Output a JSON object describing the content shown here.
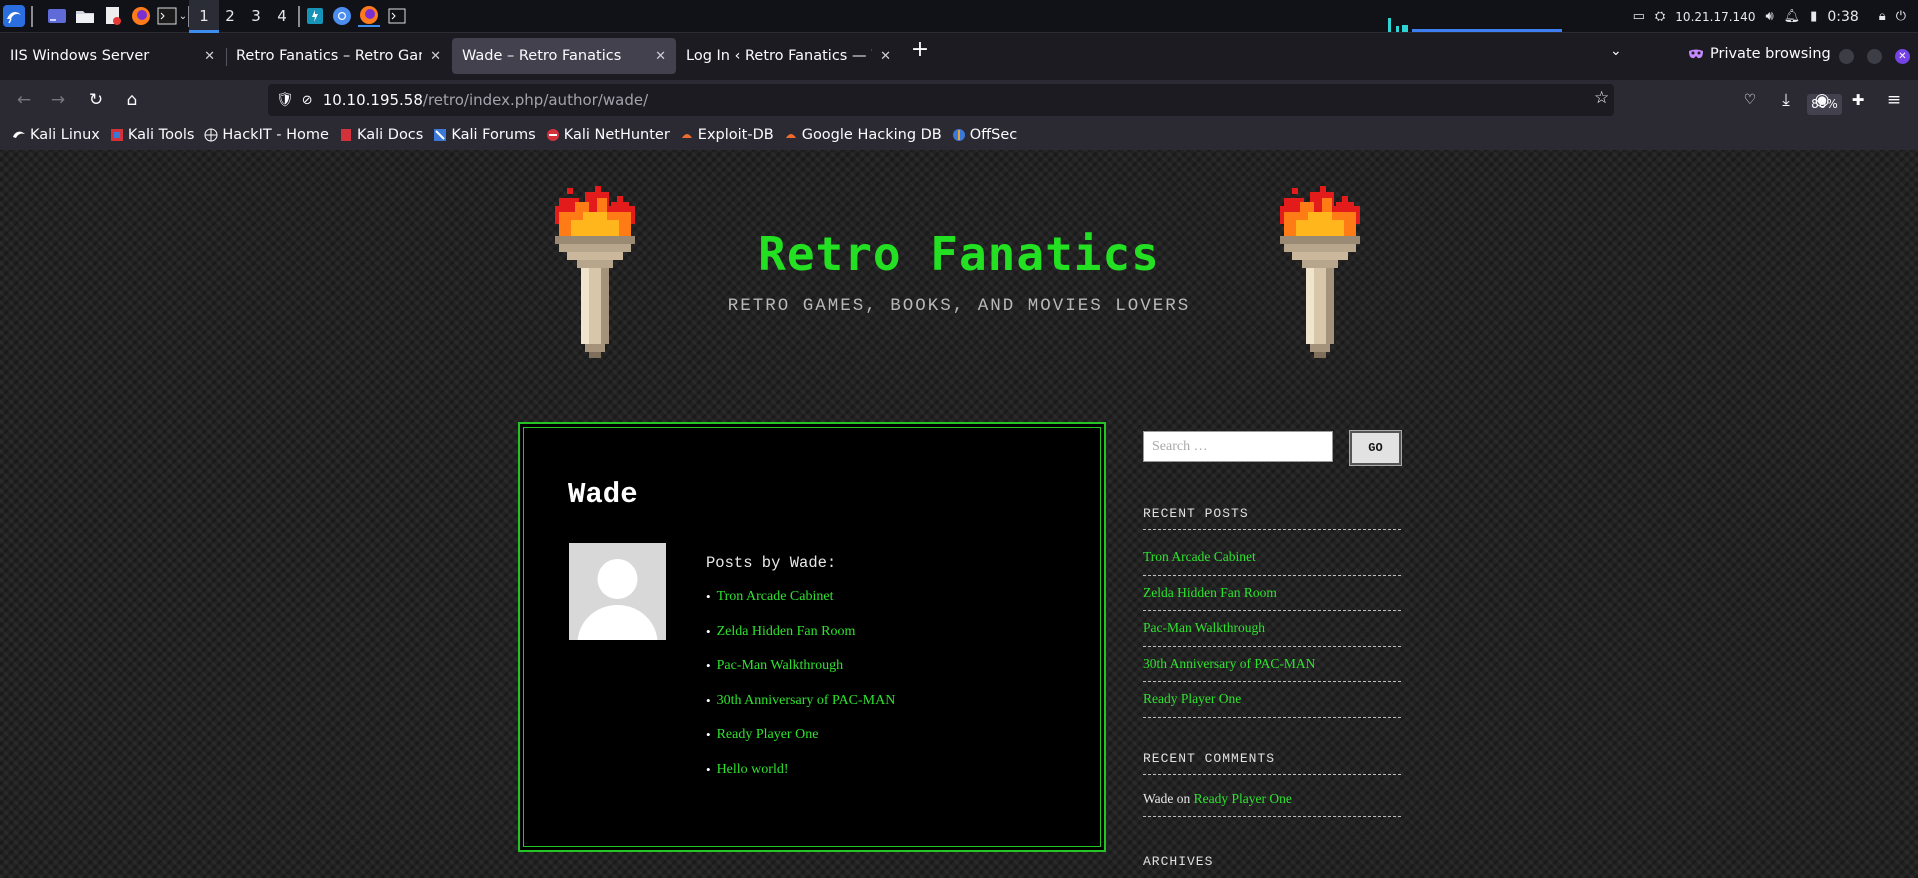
{
  "panel": {
    "workspaces": [
      "1",
      "2",
      "3",
      "4"
    ],
    "active_workspace": "1",
    "ip": "10.21.17.140",
    "clock": "0:38",
    "icons": [
      "kali-menu-icon",
      "desktop-icon",
      "file-manager-icon",
      "text-editor-icon",
      "firefox-icon",
      "terminal-icon",
      "burp-icon",
      "chromium-icon",
      "firefox-icon",
      "terminal-icon"
    ]
  },
  "tabs": [
    {
      "title": "IIS Windows Server",
      "active": false
    },
    {
      "title": "Retro Fanatics – Retro Games",
      "active": false
    },
    {
      "title": "Wade – Retro Fanatics",
      "active": true
    },
    {
      "title": "Log In ‹ Retro Fanatics — Wo",
      "active": false
    }
  ],
  "browser": {
    "private_label": "Private browsing",
    "url_host": "10.10.195.58",
    "url_path": "/retro/index.php/author/wade/",
    "zoom": "80%",
    "new_tab": "+"
  },
  "bookmarks": [
    {
      "label": "Kali Linux",
      "icon": "kali-icon"
    },
    {
      "label": "Kali Tools",
      "icon": "kali-tools-icon"
    },
    {
      "label": "HackIT - Home",
      "icon": "globe-icon"
    },
    {
      "label": "Kali Docs",
      "icon": "kali-docs-icon"
    },
    {
      "label": "Kali Forums",
      "icon": "kali-forums-icon"
    },
    {
      "label": "Kali NetHunter",
      "icon": "nethunter-icon"
    },
    {
      "label": "Exploit-DB",
      "icon": "exploit-db-icon"
    },
    {
      "label": "Google Hacking DB",
      "icon": "ghdb-icon"
    },
    {
      "label": "OffSec",
      "icon": "offsec-icon"
    }
  ],
  "site": {
    "title": "Retro Fanatics",
    "description": "RETRO GAMES, BOOKS, AND MOVIES LOVERS"
  },
  "author": {
    "name": "Wade",
    "posts_heading": "Posts by Wade:",
    "posts": [
      "Tron Arcade Cabinet",
      "Zelda Hidden Fan Room",
      "Pac-Man Walkthrough",
      "30th Anniversary of PAC-MAN",
      "Ready Player One",
      "Hello world!"
    ]
  },
  "sidebar": {
    "search_placeholder": "Search …",
    "go_label": "GO",
    "recent_posts_title": "RECENT POSTS",
    "recent_posts": [
      "Tron Arcade Cabinet",
      "Zelda Hidden Fan Room",
      "Pac-Man Walkthrough",
      "30th Anniversary of PAC-MAN",
      "Ready Player One"
    ],
    "recent_comments_title": "RECENT COMMENTS",
    "recent_comments": [
      {
        "author": "Wade",
        "on": "on",
        "post": "Ready Player One"
      }
    ],
    "archives_title": "ARCHIVES"
  },
  "colors": {
    "accent_green": "#23e023",
    "browser_accent": "#7542e5",
    "workspace_accent": "#3d8df0"
  }
}
